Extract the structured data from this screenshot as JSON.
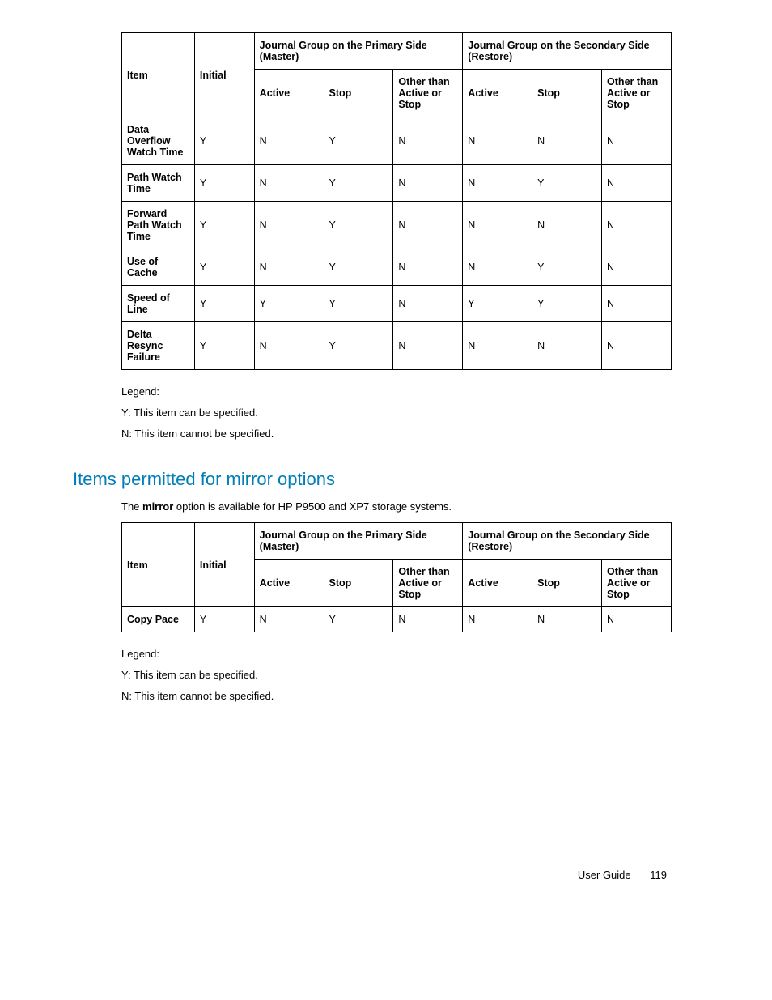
{
  "table1": {
    "hdr_item": "Item",
    "hdr_initial": "Initial",
    "hdr_primary": "Journal Group on the Primary Side (Master)",
    "hdr_secondary": "Journal Group on the Secondary Side\n(Restore)",
    "sub_active": "Active",
    "sub_stop": "Stop",
    "sub_other": "Other than Active or Stop",
    "rows": [
      {
        "item": "Data Overflow Watch Time",
        "initial": "Y",
        "p_active": "N",
        "p_stop": "Y",
        "p_other": "N",
        "s_active": "N",
        "s_stop": "N",
        "s_other": "N"
      },
      {
        "item": "Path Watch Time",
        "initial": "Y",
        "p_active": "N",
        "p_stop": "Y",
        "p_other": "N",
        "s_active": "N",
        "s_stop": "Y",
        "s_other": "N"
      },
      {
        "item": "Forward Path Watch Time",
        "initial": "Y",
        "p_active": "N",
        "p_stop": "Y",
        "p_other": "N",
        "s_active": "N",
        "s_stop": "N",
        "s_other": "N"
      },
      {
        "item": "Use of Cache",
        "initial": "Y",
        "p_active": "N",
        "p_stop": "Y",
        "p_other": "N",
        "s_active": "N",
        "s_stop": "Y",
        "s_other": "N"
      },
      {
        "item": "Speed of Line",
        "initial": "Y",
        "p_active": "Y",
        "p_stop": "Y",
        "p_other": "N",
        "s_active": "Y",
        "s_stop": "Y",
        "s_other": "N"
      },
      {
        "item": "Delta Resync Failure",
        "initial": "Y",
        "p_active": "N",
        "p_stop": "Y",
        "p_other": "N",
        "s_active": "N",
        "s_stop": "N",
        "s_other": "N"
      }
    ]
  },
  "legend1": {
    "title": "Legend:",
    "y": "Y: This item can be specified.",
    "n": "N: This item cannot be specified."
  },
  "section2": {
    "title": "Items permitted for mirror options",
    "intro_pre": "The ",
    "intro_bold": "mirror",
    "intro_post": " option is available for HP P9500 and XP7 storage systems."
  },
  "table2": {
    "hdr_item": "Item",
    "hdr_initial": "Initial",
    "hdr_primary": "Journal Group on the Primary Side (Master)",
    "hdr_secondary": "Journal Group on the Secondary Side (Restore)",
    "sub_active": "Active",
    "sub_stop": "Stop",
    "sub_other": "Other than Active or Stop",
    "sub_other2": "Other than Active or Stop",
    "rows": [
      {
        "item": "Copy Pace",
        "initial": "Y",
        "p_active": "N",
        "p_stop": "Y",
        "p_other": "N",
        "s_active": "N",
        "s_stop": "N",
        "s_other": "N"
      }
    ]
  },
  "legend2": {
    "title": "Legend:",
    "y": "Y: This item can be specified.",
    "n": "N: This item cannot be specified."
  },
  "footer": {
    "label": "User Guide",
    "page": "119"
  }
}
